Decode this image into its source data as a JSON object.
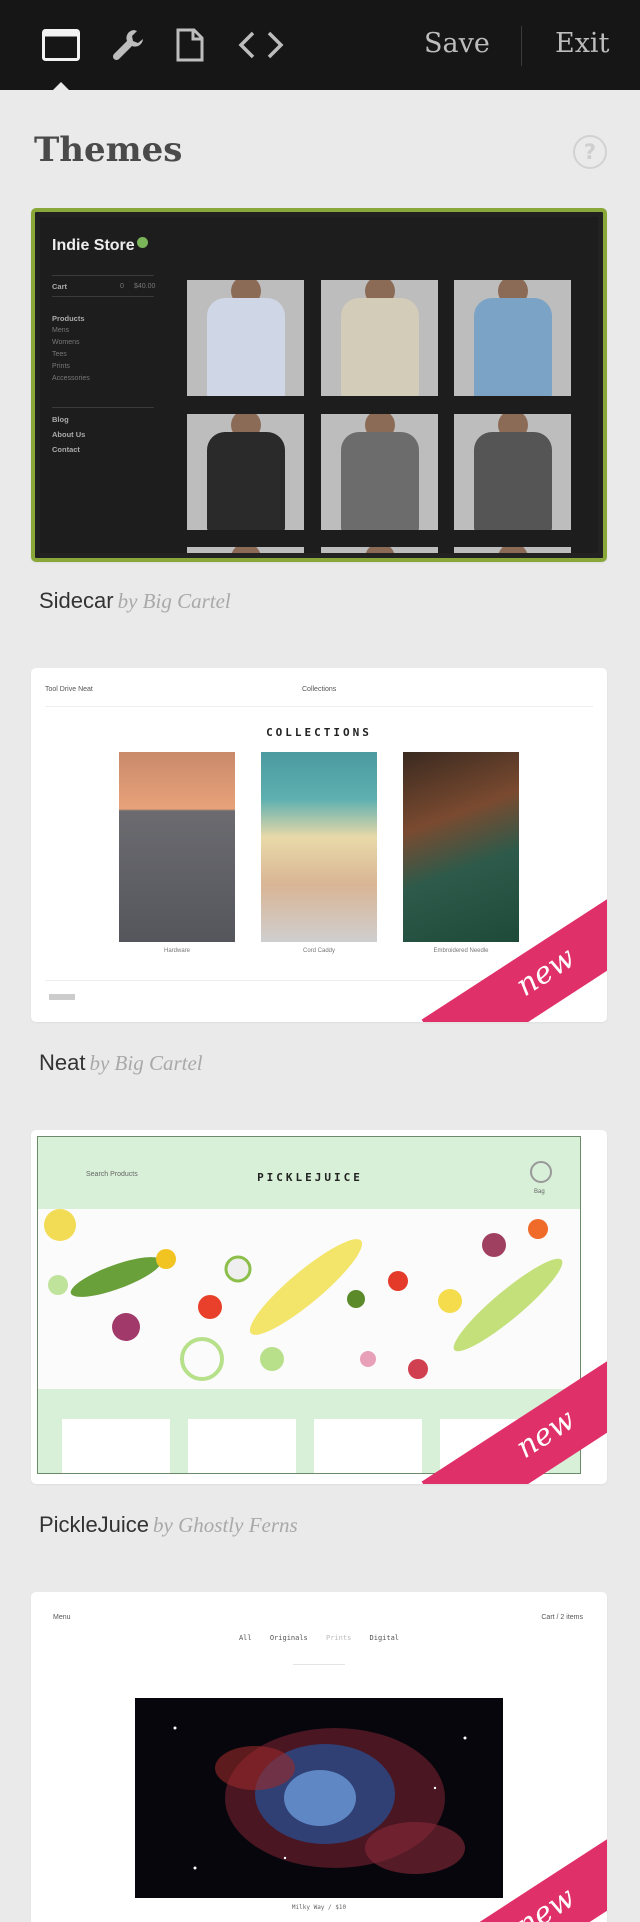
{
  "toolbar": {
    "tabs": [
      {
        "name": "design-tab",
        "icon": "browser-window-icon",
        "active": true
      },
      {
        "name": "settings-tab",
        "icon": "wrench-icon",
        "active": false
      },
      {
        "name": "pages-tab",
        "icon": "page-icon",
        "active": false
      },
      {
        "name": "code-tab",
        "icon": "code-brackets-icon",
        "active": false
      }
    ],
    "save_label": "Save",
    "exit_label": "Exit"
  },
  "page": {
    "title": "Themes",
    "help_label": "?"
  },
  "themes": [
    {
      "name": "Sidecar",
      "author": "by Big Cartel",
      "selected": true,
      "preview": {
        "store_name": "Indie Store",
        "cart": "Cart",
        "cart_count": "0",
        "cart_total": "$40.00",
        "nav": [
          "Products",
          "Mens",
          "Womens",
          "Tees",
          "Prints",
          "Accessories"
        ],
        "pages": [
          "Blog",
          "About Us",
          "Contact"
        ],
        "shirt_colors": [
          "#cfd6e6",
          "#d2ccb8",
          "#7aa3c6",
          "#2a2a2a",
          "#6c6c6c",
          "#555555"
        ]
      }
    },
    {
      "name": "Neat",
      "author": "by Big Cartel",
      "is_new": true,
      "new_label": "new",
      "preview": {
        "store_name": "Tool Drive Neat",
        "center_nav": "Collections",
        "section_title": "COLLECTIONS",
        "items": [
          "Hardware",
          "Cord Caddy",
          "Embroidered Needle"
        ]
      }
    },
    {
      "name": "PickleJuice",
      "author": "by Ghostly Ferns",
      "is_new": true,
      "new_label": "new",
      "preview": {
        "nav_label": "Search Products",
        "title": "PICKLEJUICE",
        "cart_label": "Bag"
      }
    },
    {
      "name": "",
      "author": "",
      "is_new": true,
      "new_label": "new",
      "preview": {
        "left_label": "Menu",
        "right_label": "Cart / 2 items",
        "nav": [
          "All",
          "Originals",
          "Prints",
          "Digital"
        ],
        "image_caption": "Milky Way / $10"
      }
    }
  ],
  "colors": {
    "toolbar_bg": "#161616",
    "page_bg": "#eaeaea",
    "selected_border": "#8aa83a",
    "new_ribbon": "#e0306a"
  }
}
